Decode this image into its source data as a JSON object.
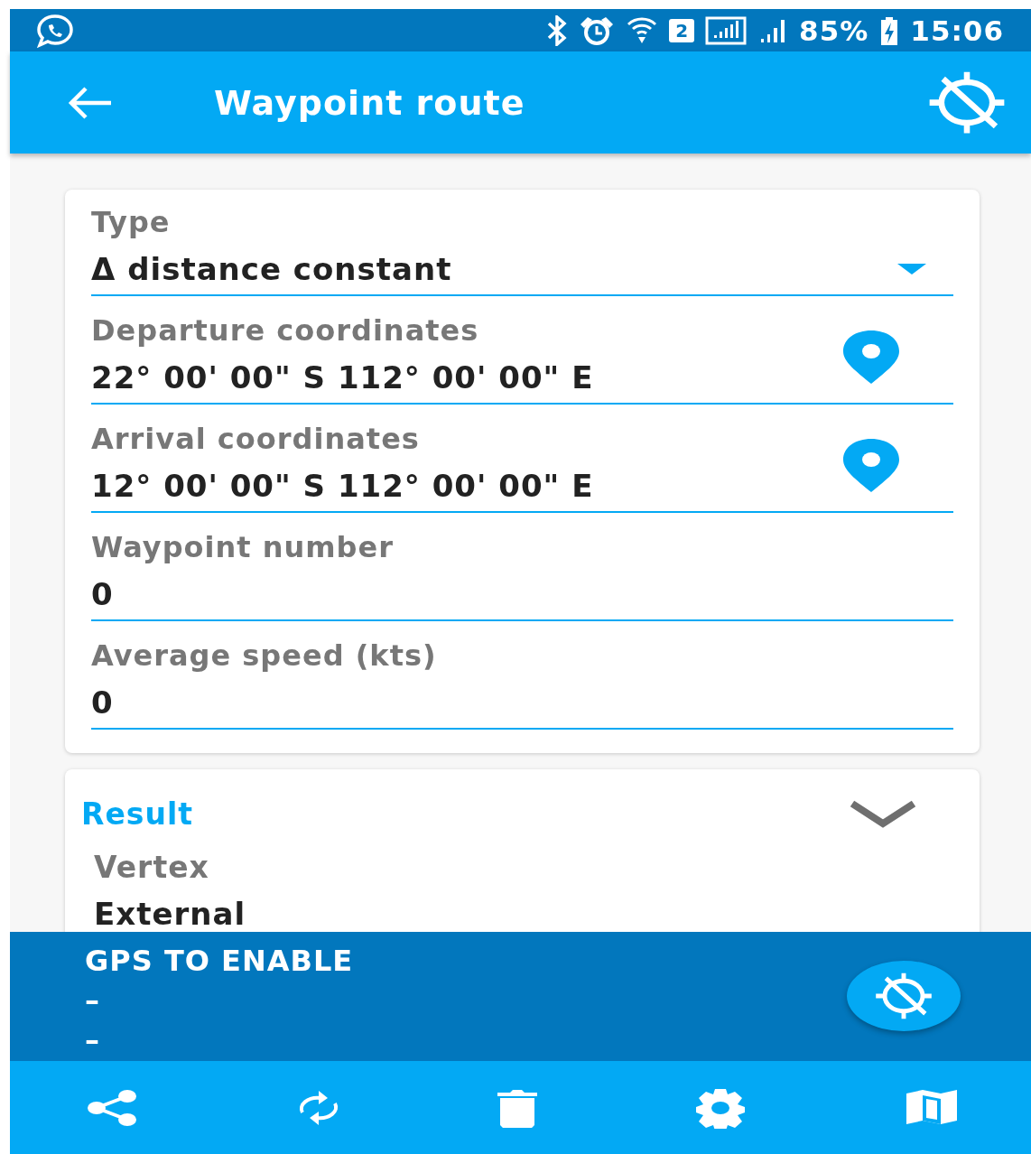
{
  "status_bar": {
    "sim_slot": "2",
    "battery": "85%",
    "time": "15:06"
  },
  "app_bar": {
    "title": "Waypoint route"
  },
  "form": {
    "fields": [
      {
        "kind": "dropdown",
        "label": "Type",
        "value": "Δ distance constant"
      },
      {
        "kind": "coordinate",
        "label": "Departure coordinates",
        "value": "22° 00' 00\" S 112° 00' 00\" E"
      },
      {
        "kind": "coordinate",
        "label": "Arrival coordinates",
        "value": "12° 00' 00\" S 112° 00' 00\" E"
      },
      {
        "kind": "number",
        "label": "Waypoint number",
        "value": "0"
      },
      {
        "kind": "number",
        "label": "Average speed (kts)",
        "value": "0"
      }
    ]
  },
  "result": {
    "title": "Result",
    "items": [
      {
        "label": "Vertex",
        "value": "External"
      }
    ]
  },
  "gps_panel": {
    "title": "GPS TO ENABLE",
    "lines": [
      "–",
      "–"
    ]
  },
  "bottom_nav": [
    {
      "kind": "share"
    },
    {
      "kind": "sync"
    },
    {
      "kind": "delete"
    },
    {
      "kind": "settings"
    },
    {
      "kind": "map"
    }
  ]
}
